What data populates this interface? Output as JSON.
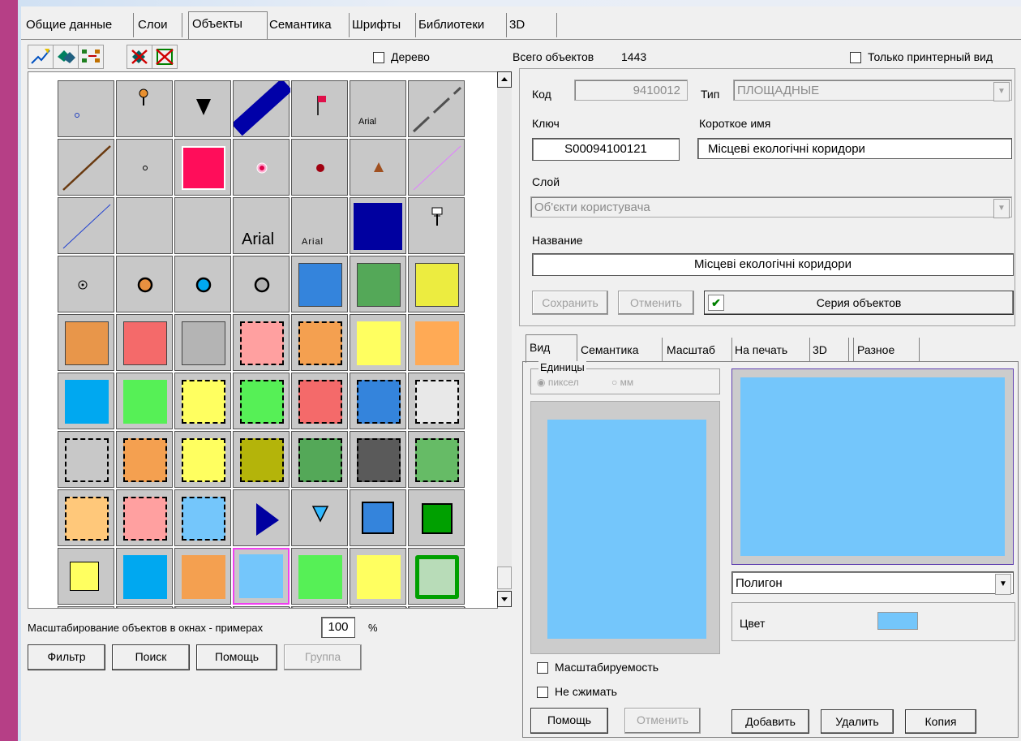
{
  "tabs": [
    "Общие данные",
    "Слои",
    "Объекты",
    "Семантика",
    "Шрифты",
    "Библиотеки",
    "3D"
  ],
  "toolbar": {
    "tree_label": "Дерево"
  },
  "grid": {
    "scale_label": "Масштабирование объектов в окнах - примерах",
    "scale_value": "100",
    "scale_unit": "%",
    "text_samples": [
      "Arial",
      "Arial",
      "Arial"
    ],
    "swatch_colors": [
      "#e8964a",
      "#f07070",
      "#b4b4b4",
      "#ffa0a0",
      "#f4a050",
      "#ffff60",
      "#ffaa55"
    ]
  },
  "bottom_buttons": {
    "filter": "Фильтр",
    "search": "Поиск",
    "help": "Помощь",
    "group": "Группа"
  },
  "info": {
    "total_label": "Всего объектов",
    "total_value": "1443",
    "printer_only": "Только принтерный вид",
    "code_label": "Код",
    "code_value": "9410012",
    "type_label": "Тип",
    "type_value": "ПЛОЩАДНЫЕ",
    "key_label": "Ключ",
    "key_value": "S00094100121",
    "short_name_label": "Короткое имя",
    "short_name_value": "Місцеві екологічні коридори",
    "layer_label": "Слой",
    "layer_value": "Об'єкти користувача",
    "name_label": "Название",
    "name_value": "Місцеві екологічні коридори",
    "save": "Сохранить",
    "cancel": "Отменить",
    "series": "Серия объектов"
  },
  "view_tabs": [
    "Вид",
    "Семантика",
    "Масштаб",
    "На печать",
    "3D",
    "Разное"
  ],
  "view": {
    "units_label": "Единицы",
    "unit_pixel": "пиксел",
    "unit_mm": "мм",
    "shape_value": "Полигон",
    "color_label": "Цвет",
    "fill_color": "#74c6fb",
    "scalable": "Масштабируемость",
    "no_compress": "Не сжимать",
    "help": "Помощь",
    "cancel": "Отменить",
    "add": "Добавить",
    "delete": "Удалить",
    "copy": "Копия"
  }
}
